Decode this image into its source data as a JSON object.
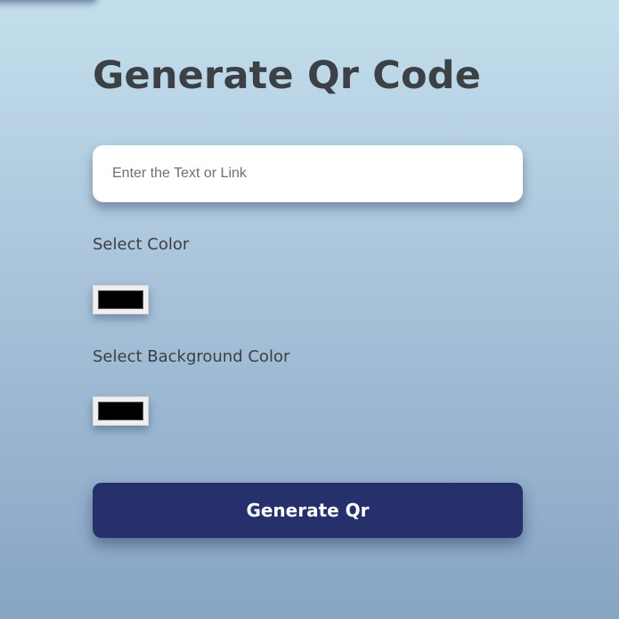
{
  "page": {
    "title": "Generate Qr Code"
  },
  "text_input": {
    "placeholder": "Enter the Text or Link",
    "value": ""
  },
  "color_picker": {
    "label": "Select Color",
    "value": "#000000"
  },
  "background_color_picker": {
    "label": "Select Background Color",
    "value": "#000000"
  },
  "generate_button": {
    "label": "Generate Qr",
    "color": "#26316c"
  }
}
